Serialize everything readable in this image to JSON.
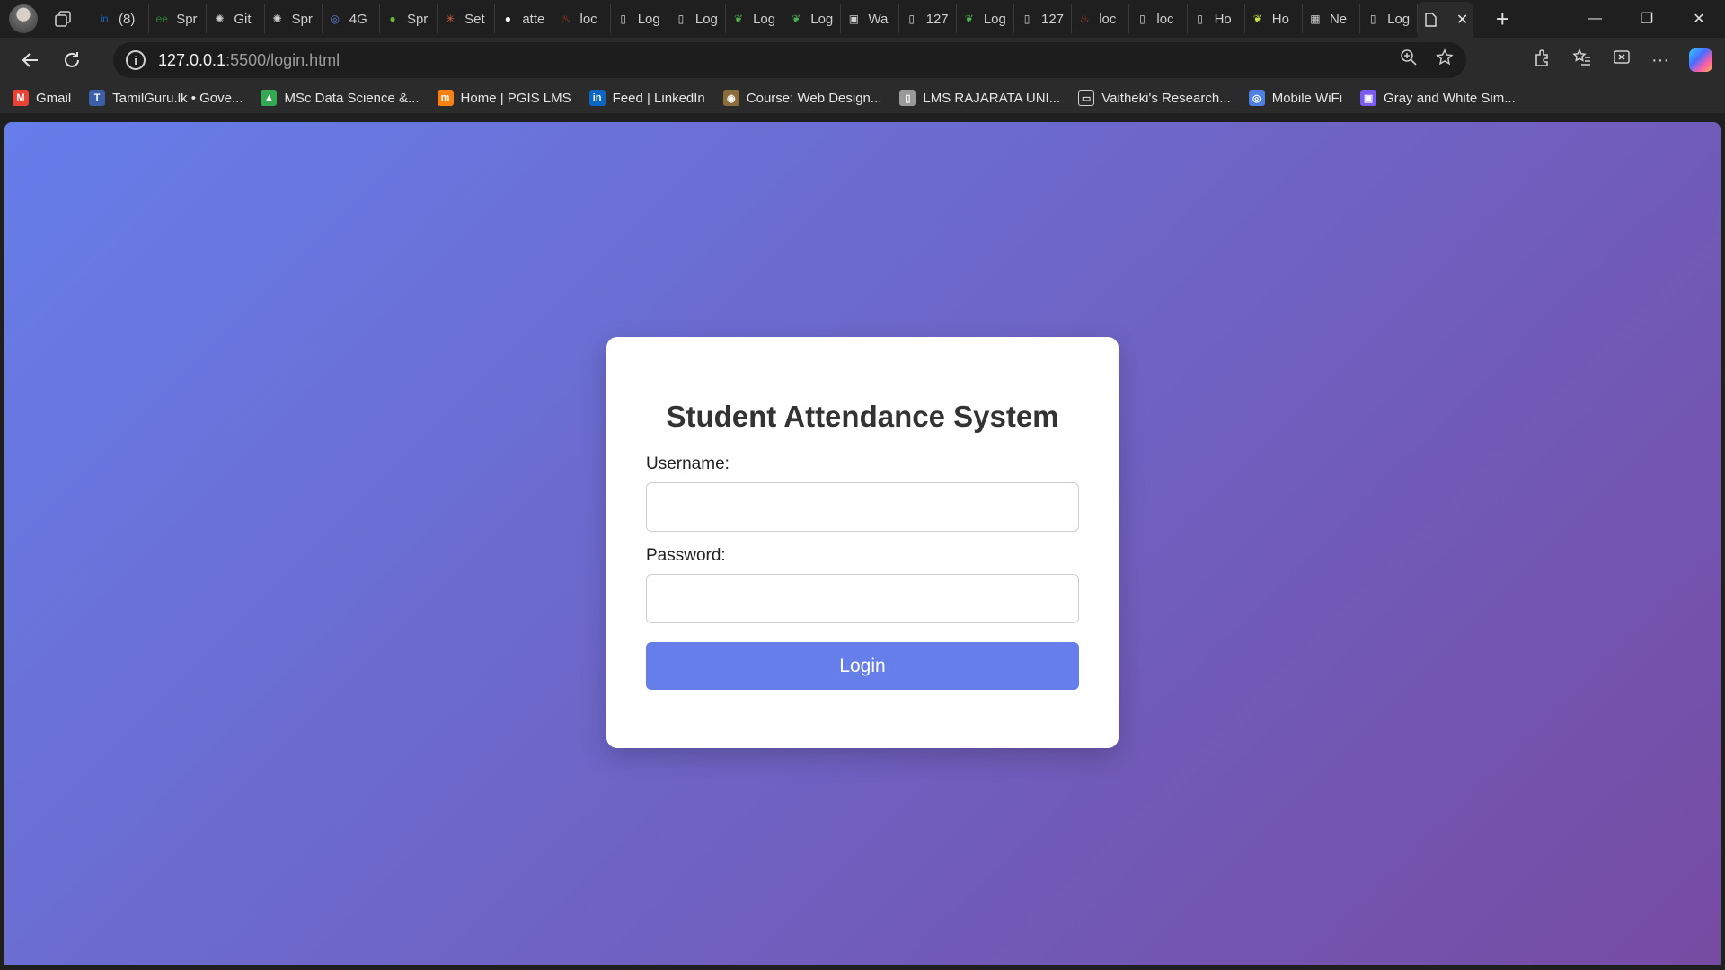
{
  "browser": {
    "tabs": [
      {
        "icon": "linkedin-icon",
        "label": "(8)",
        "color": "#0a66c2",
        "glyph": "in"
      },
      {
        "icon": "gradle-icon",
        "label": "Spr",
        "color": "#2e7d32",
        "glyph": "ee"
      },
      {
        "icon": "openai-icon",
        "label": "Git",
        "color": "#d0d0d0",
        "glyph": "✺"
      },
      {
        "icon": "openai-icon",
        "label": "Spr",
        "color": "#d0d0d0",
        "glyph": "✺"
      },
      {
        "icon": "edge-circle-icon",
        "label": "4G",
        "color": "#5b7bd5",
        "glyph": "◎"
      },
      {
        "icon": "spring-leaf-icon",
        "label": "Spr",
        "color": "#6db33f",
        "glyph": "●"
      },
      {
        "icon": "claude-asterisk-icon",
        "label": "Set",
        "color": "#d9653b",
        "glyph": "✳"
      },
      {
        "icon": "github-icon",
        "label": "atte",
        "color": "#ffffff",
        "glyph": "●"
      },
      {
        "icon": "flame-icon",
        "label": "loc",
        "color": "#e8501e",
        "glyph": "♨"
      },
      {
        "icon": "document-icon",
        "label": "Log",
        "color": "#d0d0d0",
        "glyph": "▯"
      },
      {
        "icon": "document-icon",
        "label": "Log",
        "color": "#d0d0d0",
        "glyph": "▯"
      },
      {
        "icon": "mongodb-leaf-icon",
        "label": "Log",
        "color": "#4caf50",
        "glyph": "❦"
      },
      {
        "icon": "mongodb-leaf-icon",
        "label": "Log",
        "color": "#4caf50",
        "glyph": "❦"
      },
      {
        "icon": "whatsapp-box-icon",
        "label": "Wa",
        "color": "#d0d0d0",
        "glyph": "▣"
      },
      {
        "icon": "document-error-icon",
        "label": "127",
        "color": "#d0d0d0",
        "glyph": "▯"
      },
      {
        "icon": "mongodb-leaf-icon",
        "label": "Log",
        "color": "#4caf50",
        "glyph": "❦"
      },
      {
        "icon": "document-icon",
        "label": "127",
        "color": "#d0d0d0",
        "glyph": "▯"
      },
      {
        "icon": "flame-icon",
        "label": "loc",
        "color": "#e8501e",
        "glyph": "♨"
      },
      {
        "icon": "document-error-icon",
        "label": "loc",
        "color": "#d0d0d0",
        "glyph": "▯"
      },
      {
        "icon": "document-icon",
        "label": "Ho",
        "color": "#d0d0d0",
        "glyph": "▯"
      },
      {
        "icon": "mongodb-leaf-icon",
        "label": "Ho",
        "color": "#c6e23a",
        "glyph": "❦"
      },
      {
        "icon": "calendar-icon",
        "label": "Ne",
        "color": "#d0d0d0",
        "glyph": "▦"
      },
      {
        "icon": "document-icon",
        "label": "Log",
        "color": "#d0d0d0",
        "glyph": "▯"
      }
    ],
    "active_tab": {
      "icon": "document-icon",
      "close": "✕"
    },
    "new_tab": "+",
    "window_controls": {
      "minimize": "—",
      "restore": "❐",
      "close": "✕"
    },
    "address": {
      "host": "127.0.0.1",
      "rest": ":5500/login.html"
    },
    "bookmarks": [
      {
        "label": "Gmail",
        "icon": "gmail-icon",
        "color": "#ea4335",
        "glyph": "M"
      },
      {
        "label": "TamilGuru.lk • Gove...",
        "icon": "tamilguru-icon",
        "color": "#3b5fa8",
        "glyph": "T"
      },
      {
        "label": "MSc Data Science &...",
        "icon": "google-drive-icon",
        "color": "#34a853",
        "glyph": "▲"
      },
      {
        "label": "Home | PGIS LMS",
        "icon": "moodle-icon",
        "color": "#f98012",
        "glyph": "m"
      },
      {
        "label": "Feed | LinkedIn",
        "icon": "linkedin-icon",
        "color": "#0a66c2",
        "glyph": "in"
      },
      {
        "label": "Course: Web Design...",
        "icon": "university-crest-icon",
        "color": "#8a6d3b",
        "glyph": "◉"
      },
      {
        "label": "LMS RAJARATA UNI...",
        "icon": "document-icon",
        "color": "#9a9a9a",
        "glyph": "▯"
      },
      {
        "label": "Vaitheki's Research...",
        "icon": "folder-icon",
        "color": "#2b2b2b",
        "glyph": "▭"
      },
      {
        "label": "Mobile WiFi",
        "icon": "edge-circle-icon",
        "color": "#4f7fe0",
        "glyph": "◎"
      },
      {
        "label": "Gray and White Sim...",
        "icon": "canva-icon",
        "color": "#7b5cf0",
        "glyph": "▣"
      }
    ]
  },
  "page": {
    "title": "Student Attendance System",
    "username_label": "Username:",
    "username_value": "",
    "password_label": "Password:",
    "password_value": "",
    "login_button": "Login",
    "accent_color": "#667eea",
    "gradient_end": "#764ba2"
  }
}
